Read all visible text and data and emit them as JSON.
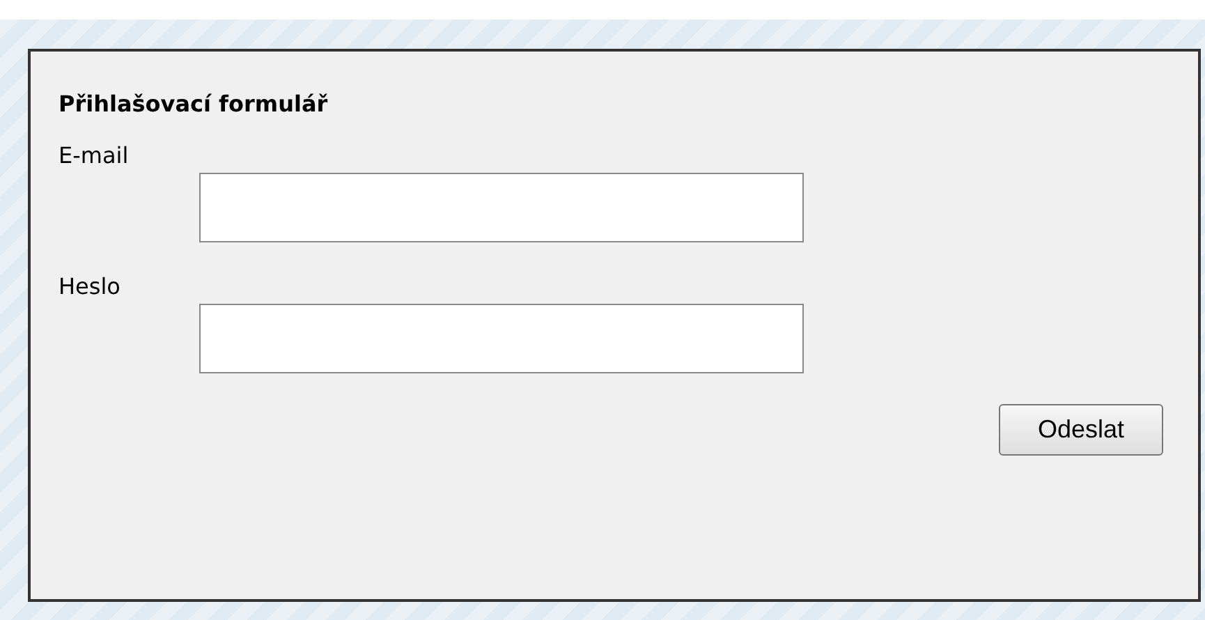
{
  "form": {
    "title": "Přihlašovací formulář",
    "fields": [
      {
        "label": "E-mail"
      },
      {
        "label": "Heslo"
      }
    ],
    "submit": "Odeslat"
  }
}
